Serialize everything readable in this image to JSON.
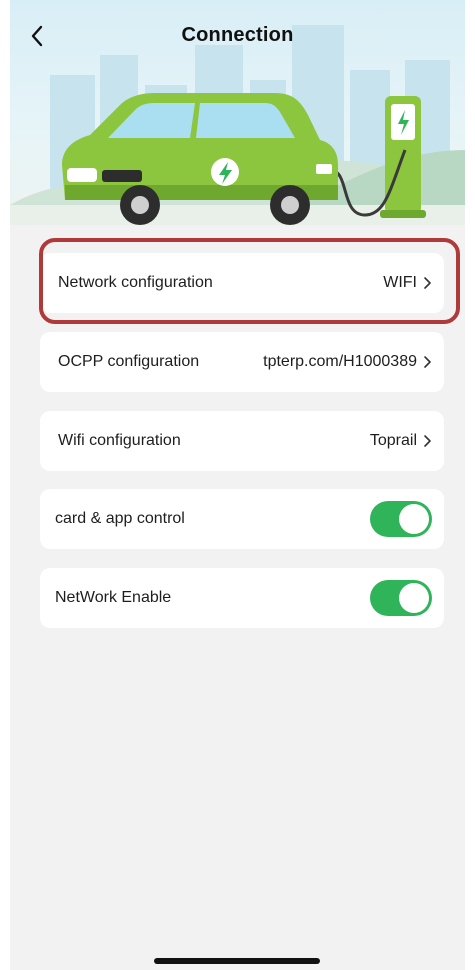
{
  "header": {
    "title": "Connection"
  },
  "rows": [
    {
      "label": "Network configuration",
      "value": "WIFI"
    },
    {
      "label": "OCPP configuration",
      "value": "tpterp.com/H1000389"
    },
    {
      "label": "Wifi configuration",
      "value": "Toprail"
    },
    {
      "label": "card & app control",
      "toggle_on": true
    },
    {
      "label": "NetWork Enable",
      "toggle_on": true
    }
  ],
  "colors": {
    "toggle_on": "#2fb45a",
    "highlight_border": "#b03a3a",
    "car_green": "#8cc63f",
    "background": "#f2f2f2"
  }
}
